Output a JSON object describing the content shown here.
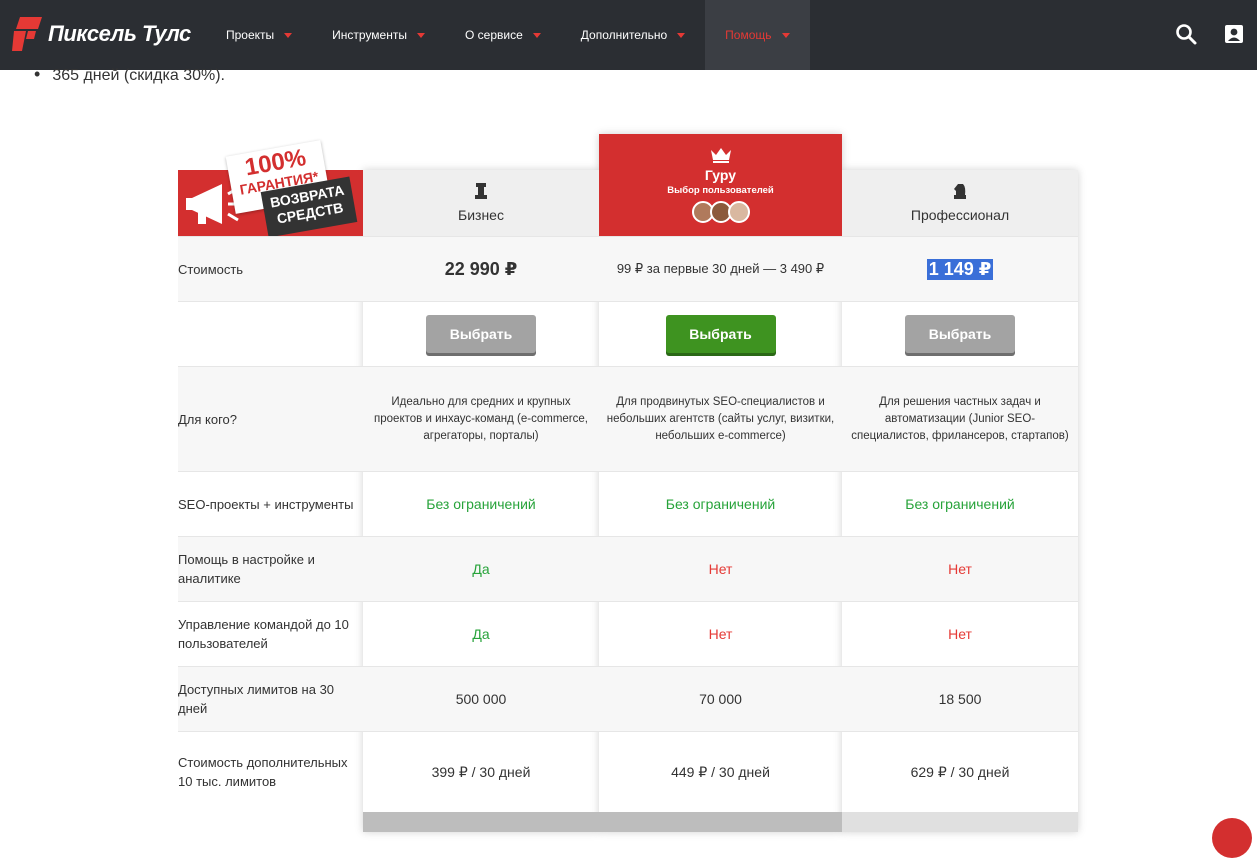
{
  "brand": {
    "name": "Пиксель Тулс"
  },
  "nav": {
    "items": [
      {
        "label": "Проекты"
      },
      {
        "label": "Инструменты"
      },
      {
        "label": "О сервисе"
      },
      {
        "label": "Дополнительно"
      },
      {
        "label": "Помощь",
        "active": true
      }
    ]
  },
  "intro": {
    "bullet": "365 дней (скидка 30%)."
  },
  "badge": {
    "line1": "100%",
    "line2": "ГАРАНТИЯ*",
    "line3": "ВОЗВРАТА",
    "line4": "СРЕДСТВ"
  },
  "plans": [
    {
      "name": "Бизнес",
      "price": "22 990 ₽",
      "button": "Выбрать",
      "audience": "Идеально для средних и крупных проектов и инхаус-команд (e-commerce, агрегаторы, порталы)",
      "seo": "Без ограничений",
      "help": "Да",
      "team": "Да",
      "limits": "500 000",
      "extra": "399 ₽ / 30 дней"
    },
    {
      "name": "Гуру",
      "subtitle": "Выбор пользователей",
      "price": "99 ₽ за первые 30 дней — 3 490 ₽",
      "button": "Выбрать",
      "audience": "Для продвинутых SEO-специалистов и небольших агентств (сайты услуг, визитки, небольших e-commerce)",
      "seo": "Без ограничений",
      "help": "Нет",
      "team": "Нет",
      "limits": "70 000",
      "extra": "449 ₽ / 30 дней"
    },
    {
      "name": "Профессионал",
      "price": "1 149 ₽",
      "button": "Выбрать",
      "audience": "Для решения частных задач и автоматизации (Junior SEO-специалистов, фрилансеров, стартапов)",
      "seo": "Без ограничений",
      "help": "Нет",
      "team": "Нет",
      "limits": "18 500",
      "extra": "629 ₽ / 30 дней"
    }
  ],
  "rows": {
    "price": "Стоимость",
    "audience": "Для кого?",
    "seo": "SEO-проекты + инструменты",
    "help": "Помощь в настройке и аналитике",
    "team": "Управление командой до 10 пользователей",
    "limits": "Доступных лимитов на 30 дней",
    "extra": "Стоимость дополнительных 10 тыс. лимитов"
  },
  "colors": {
    "accent": "#d32f2f",
    "nav_bg": "#2b2e33",
    "positive": "#27a33a",
    "negative": "#e53935",
    "select_hl": "#3a6fd8"
  }
}
